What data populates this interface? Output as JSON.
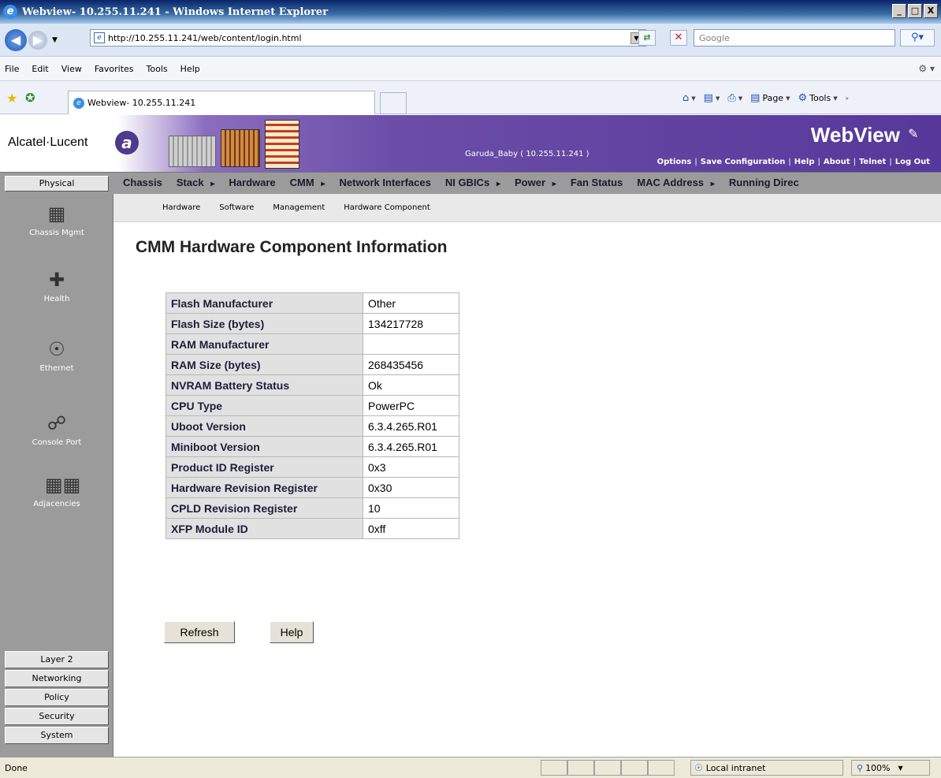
{
  "window": {
    "title": "Webview- 10.255.11.241 - Windows Internet Explorer",
    "minimize": "_",
    "maximize": "□",
    "close": "X"
  },
  "address": {
    "url": "http://10.255.11.241/web/content/login.html",
    "search_placeholder": "Google"
  },
  "menu": {
    "items": [
      "File",
      "Edit",
      "View",
      "Favorites",
      "Tools",
      "Help"
    ]
  },
  "tab": {
    "label": "Webview- 10.255.11.241"
  },
  "commands": {
    "page": "Page",
    "tools": "Tools"
  },
  "header": {
    "brand": "Alcatel·Lucent",
    "host": "Garuda_Baby  ( 10.255.11.241 )",
    "app_title": "WebView",
    "links": [
      "Options",
      "Save Configuration",
      "Help",
      "About",
      "Telnet",
      "Log Out"
    ]
  },
  "category": {
    "physical": "Physical"
  },
  "topnav": {
    "items": [
      {
        "label": "Chassis",
        "arrow": false
      },
      {
        "label": "Stack",
        "arrow": true
      },
      {
        "label": "Hardware",
        "arrow": false
      },
      {
        "label": "CMM",
        "arrow": true
      },
      {
        "label": "Network Interfaces",
        "arrow": false
      },
      {
        "label": "NI GBICs",
        "arrow": true
      },
      {
        "label": "Power",
        "arrow": true
      },
      {
        "label": "Fan Status",
        "arrow": false
      },
      {
        "label": "MAC Address",
        "arrow": true
      },
      {
        "label": "Running Direc",
        "arrow": false
      }
    ]
  },
  "submenu": {
    "items": [
      "Hardware",
      "Software",
      "Management",
      "Hardware Component"
    ]
  },
  "sidebar": {
    "items": [
      {
        "label": "Chassis Mgmt",
        "icon": "chassis-icon"
      },
      {
        "label": "Health",
        "icon": "health-icon"
      },
      {
        "label": "Ethernet",
        "icon": "ethernet-icon"
      },
      {
        "label": "Console Port",
        "icon": "console-port-icon"
      },
      {
        "label": "Adjacencies",
        "icon": "adjacencies-icon"
      }
    ],
    "categories": [
      "Layer 2",
      "Networking",
      "Policy",
      "Security",
      "System"
    ]
  },
  "content": {
    "title": "CMM Hardware Component Information",
    "rows": [
      {
        "label": "Flash Manufacturer",
        "value": "Other"
      },
      {
        "label": "Flash Size (bytes)",
        "value": "134217728"
      },
      {
        "label": "RAM Manufacturer",
        "value": ""
      },
      {
        "label": "RAM Size (bytes)",
        "value": "268435456"
      },
      {
        "label": "NVRAM Battery Status",
        "value": "Ok"
      },
      {
        "label": "CPU Type",
        "value": "PowerPC"
      },
      {
        "label": "Uboot Version",
        "value": "6.3.4.265.R01"
      },
      {
        "label": "Miniboot Version",
        "value": "6.3.4.265.R01"
      },
      {
        "label": "Product ID Register",
        "value": "0x3"
      },
      {
        "label": "Hardware Revision Register",
        "value": "0x30"
      },
      {
        "label": "CPLD Revision Register",
        "value": "10"
      },
      {
        "label": "XFP Module ID",
        "value": "0xff"
      }
    ],
    "refresh_label": "Refresh",
    "help_label": "Help"
  },
  "status": {
    "text": "Done",
    "zone": "Local intranet",
    "zoom": "100%"
  },
  "colors": {
    "header_purple": "#6b4ea8",
    "sidebar_gray": "#9b9b9b",
    "table_label_bg": "#e1e1e1"
  }
}
